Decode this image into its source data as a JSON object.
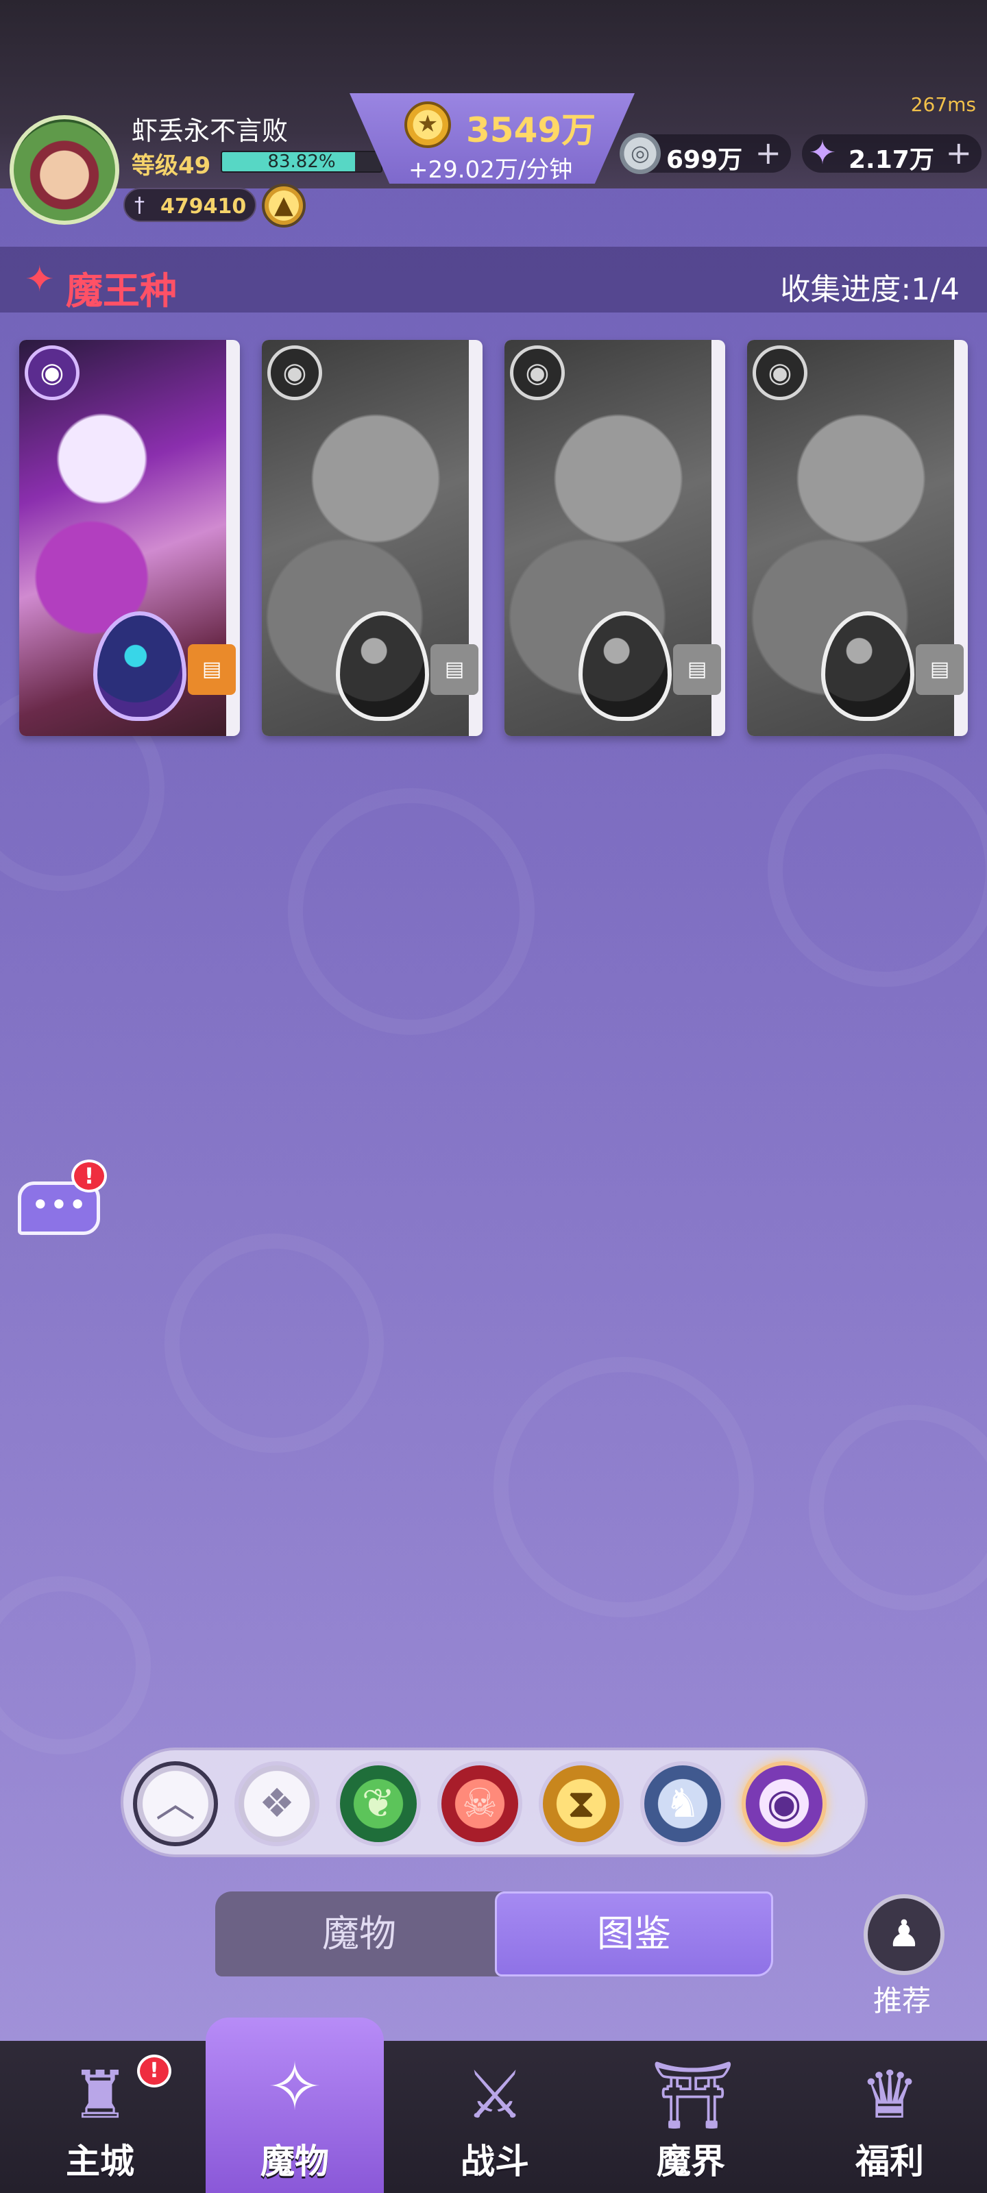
{
  "status": {
    "ping": "267ms"
  },
  "player": {
    "name": "虾丢永不言败",
    "level_label": "等级49",
    "xp_percent_text": "83.82%",
    "xp_fraction": 0.8382,
    "power_value": "479410"
  },
  "currency": {
    "gold": "3549万",
    "gold_rate": "+29.02万/分钟",
    "silver": "699万",
    "crystal": "2.17万",
    "plus": "+"
  },
  "section": {
    "title": "魔王种",
    "progress": "收集进度:1/4"
  },
  "cards": [
    {
      "unlocked": true
    },
    {
      "unlocked": false
    },
    {
      "unlocked": false
    },
    {
      "unlocked": false
    }
  ],
  "chat": {
    "alert": "!"
  },
  "filters": [
    "collapse-up-icon",
    "all-diamond-icon",
    "nature-leaf-icon",
    "demon-skull-icon",
    "time-hourglass-icon",
    "dragon-icon",
    "eye-icon"
  ],
  "tabs": {
    "monster": "魔物",
    "book": "图鉴",
    "active": "book"
  },
  "recommend": {
    "label": "推荐"
  },
  "nav": {
    "items": [
      {
        "id": "castle",
        "label": "主城",
        "icon": "castle-icon",
        "alert": "!"
      },
      {
        "id": "monster",
        "label": "魔物",
        "icon": "flame-icon",
        "active": true
      },
      {
        "id": "battle",
        "label": "战斗",
        "icon": "shield-sword-icon"
      },
      {
        "id": "realm",
        "label": "魔界",
        "icon": "portal-icon"
      },
      {
        "id": "welfare",
        "label": "福利",
        "icon": "chest-icon"
      }
    ]
  },
  "colors": {
    "accent": "#8f72e6",
    "title_red": "#ff5166",
    "gold": "#ffd866"
  }
}
